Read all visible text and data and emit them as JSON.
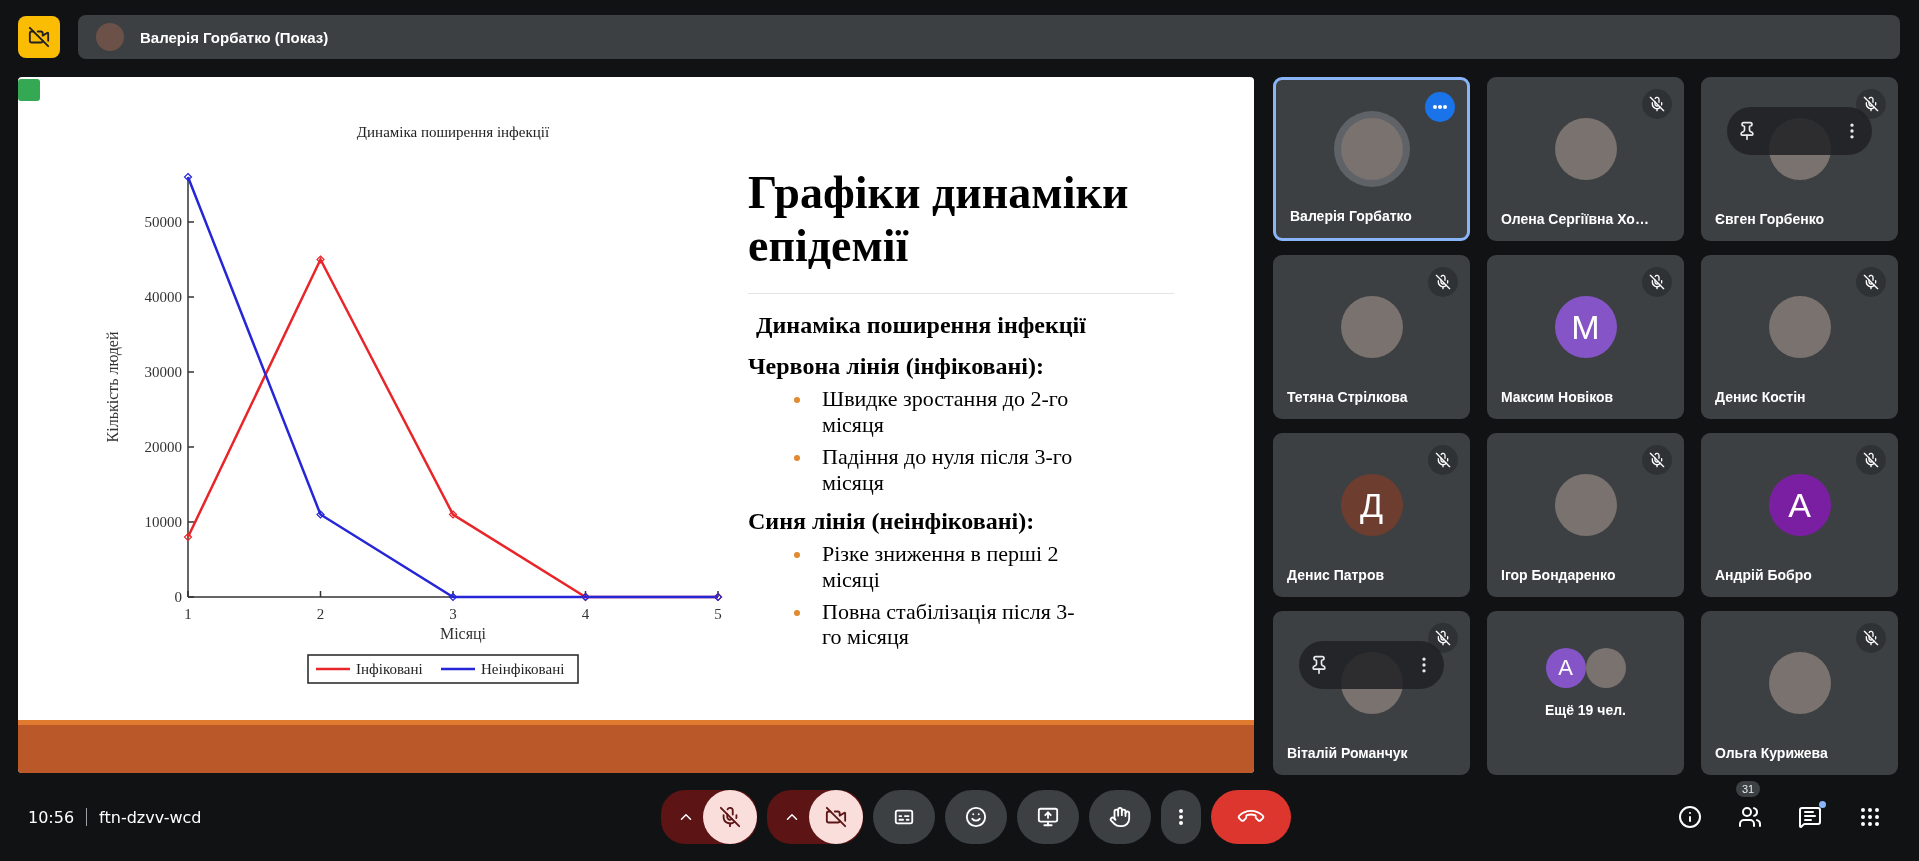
{
  "top_bar": {
    "presenter": "Валерія Горбатко (Показ)"
  },
  "slide": {
    "title": "Графіки динаміки епідемії",
    "subtitle": "Динаміка поширення інфекції",
    "sections": [
      {
        "heading": "Червона лінія (інфіковані):",
        "bullets": [
          "Швидке зростання до 2-го місяця",
          "Падіння до нуля після 3-го місяця"
        ]
      },
      {
        "heading": "Синя лінія (неінфіковані):",
        "bullets": [
          "Різке зниження в перші 2 місяці",
          "Повна стабілізація після 3-го місяця"
        ]
      }
    ],
    "chart_data": {
      "type": "line",
      "title": "Динаміка поширення інфекції",
      "xlabel": "Місяці",
      "ylabel": "Кількість людей",
      "x": [
        1,
        2,
        3,
        4,
        5
      ],
      "xlim": [
        1,
        5
      ],
      "ylim": [
        0,
        56000
      ],
      "xticks": [
        1,
        2,
        3,
        4,
        5
      ],
      "yticks": [
        0,
        10000,
        20000,
        30000,
        40000,
        50000
      ],
      "legend": "bottom",
      "series": [
        {
          "name": "Інфіковані",
          "color": "#e8262a",
          "marker": "diamond",
          "values": [
            8000,
            45000,
            11000,
            0,
            0
          ]
        },
        {
          "name": "Неінфіковані",
          "color": "#2626d9",
          "marker": "diamond",
          "values": [
            56000,
            11000,
            0,
            0,
            0
          ]
        }
      ]
    }
  },
  "tiles": [
    {
      "kind": "person",
      "name": "Валерія Горбатко",
      "avatar": {
        "kind": "photo"
      },
      "speaking": true,
      "muted": false,
      "hover_controls": false
    },
    {
      "kind": "person",
      "name": "Олена Сергіївна Хо…",
      "avatar": {
        "kind": "photo"
      },
      "speaking": false,
      "muted": true,
      "hover_controls": false
    },
    {
      "kind": "person",
      "name": "Євген Горбенко",
      "avatar": {
        "kind": "photo"
      },
      "speaking": false,
      "muted": true,
      "hover_controls": true
    },
    {
      "kind": "person",
      "name": "Тетяна Стрілкова",
      "avatar": {
        "kind": "photo"
      },
      "speaking": false,
      "muted": true,
      "hover_controls": false
    },
    {
      "kind": "person",
      "name": "Максим Новіков",
      "avatar": {
        "kind": "letter",
        "letter": "M",
        "color": "#8555c8"
      },
      "speaking": false,
      "muted": true,
      "hover_controls": false
    },
    {
      "kind": "person",
      "name": "Денис Костін",
      "avatar": {
        "kind": "photo"
      },
      "speaking": false,
      "muted": true,
      "hover_controls": false
    },
    {
      "kind": "person",
      "name": "Денис Патров",
      "avatar": {
        "kind": "letter",
        "letter": "Д",
        "color": "#6d3d2f"
      },
      "speaking": false,
      "muted": true,
      "hover_controls": false
    },
    {
      "kind": "person",
      "name": "Ігор Бондаренко",
      "avatar": {
        "kind": "photo"
      },
      "speaking": false,
      "muted": true,
      "hover_controls": false
    },
    {
      "kind": "person",
      "name": "Андрій Бобро",
      "avatar": {
        "kind": "letter",
        "letter": "А",
        "color": "#7b1fa2"
      },
      "speaking": false,
      "muted": true,
      "hover_controls": false
    },
    {
      "kind": "person",
      "name": "Віталій Романчук",
      "avatar": {
        "kind": "photo"
      },
      "speaking": false,
      "muted": true,
      "hover_controls": true
    },
    {
      "kind": "others",
      "label": "Ещё 19 чел.",
      "avatars": [
        {
          "kind": "letter",
          "letter": "A",
          "color": "#8555c8"
        },
        {
          "kind": "photo"
        }
      ]
    },
    {
      "kind": "person",
      "name": "Ольга Курижева",
      "avatar": {
        "kind": "photo"
      },
      "speaking": false,
      "muted": true,
      "hover_controls": false
    }
  ],
  "bottom_bar": {
    "time": "10:56",
    "meeting_code": "ftn-dzvv-wcd",
    "controls": [
      {
        "kind": "mic",
        "off": true
      },
      {
        "kind": "camera",
        "off": true
      },
      {
        "kind": "captions",
        "off": false
      },
      {
        "kind": "reactions",
        "off": false
      },
      {
        "kind": "present",
        "off": false
      },
      {
        "kind": "hand",
        "off": false
      },
      {
        "kind": "more",
        "off": false
      },
      {
        "kind": "end",
        "off": false
      }
    ],
    "side": [
      {
        "kind": "info"
      },
      {
        "kind": "people",
        "badge": "31"
      },
      {
        "kind": "chat",
        "dot": true
      },
      {
        "kind": "apps"
      }
    ]
  }
}
